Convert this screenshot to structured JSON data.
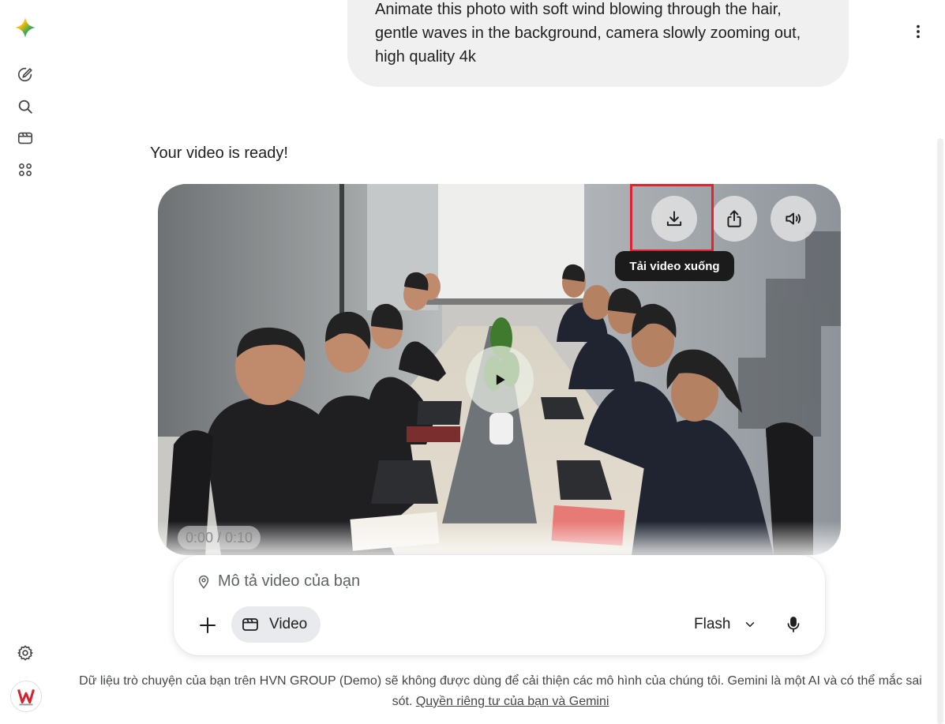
{
  "user_message": {
    "lines": [
      "Animate this photo with soft wind blowing through the hair,",
      "gentle waves in the background, camera slowly zooming out,",
      "high quality 4k"
    ]
  },
  "response": {
    "text": "Your video is ready!"
  },
  "video": {
    "timecode": "0:00 / 0:10",
    "tooltip": "Tải video xuống",
    "actions": [
      "download-icon",
      "share-icon",
      "volume-icon",
      "play-icon"
    ]
  },
  "composer": {
    "placeholder": "Mô tả video của bạn",
    "tool_chip": "Video",
    "model": "Flash"
  },
  "footer": {
    "text": "Dữ liệu trò chuyện của bạn trên HVN GROUP (Demo) sẽ không được dùng để cải thiện các mô hình của chúng tôi. Gemini là một AI và có thể mắc sai sót.",
    "link": "Quyền riêng tư của bạn và Gemini"
  },
  "sidebar": {
    "icons": [
      "gemini-logo-icon",
      "new-chat-icon",
      "search-icon",
      "video-icon",
      "apps-icon",
      "settings-icon"
    ]
  },
  "colors": {
    "highlight": "#e3212f",
    "tooltip_bg": "#1b1b1b",
    "bubble_bg": "#f0f0f0"
  }
}
